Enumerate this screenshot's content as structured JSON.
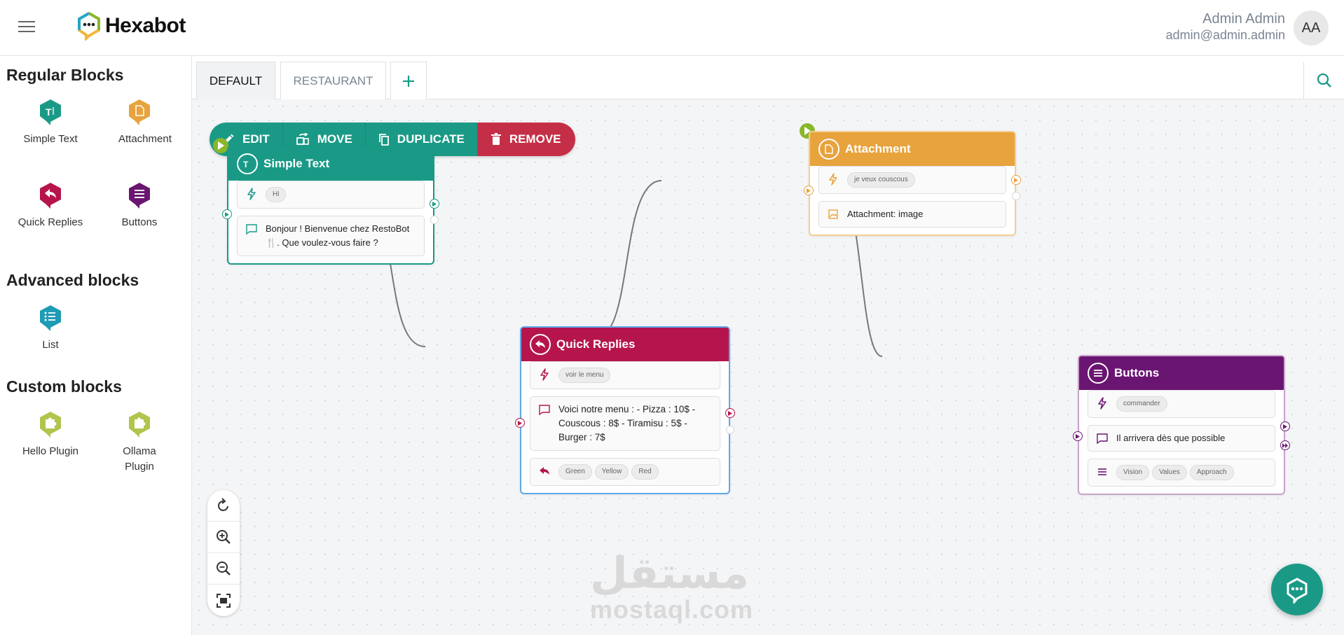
{
  "app": {
    "name": "Hexabot"
  },
  "user": {
    "name": "Admin Admin",
    "email": "admin@admin.admin",
    "initials": "AA"
  },
  "sidebar": {
    "sections": [
      {
        "title": "Regular Blocks",
        "blocks": [
          {
            "label": "Simple Text",
            "icon": "simple-text-icon",
            "color": "#1a9a86"
          },
          {
            "label": "Attachment",
            "icon": "attachment-icon",
            "color": "#e8a33d"
          },
          {
            "label": "Quick Replies",
            "icon": "quick-replies-icon",
            "color": "#b5154c"
          },
          {
            "label": "Buttons",
            "icon": "buttons-icon",
            "color": "#6b1572"
          }
        ]
      },
      {
        "title": "Advanced blocks",
        "blocks": [
          {
            "label": "List",
            "icon": "list-icon",
            "color": "#1e9bb5"
          }
        ]
      },
      {
        "title": "Custom blocks",
        "blocks": [
          {
            "label": "Hello Plugin",
            "icon": "puzzle-icon",
            "color": "#b2c44c"
          },
          {
            "label": "Ollama Plugin",
            "icon": "puzzle-icon",
            "color": "#b2c44c"
          }
        ]
      }
    ]
  },
  "tabs": [
    {
      "label": "DEFAULT",
      "active": true
    },
    {
      "label": "RESTAURANT",
      "active": false
    }
  ],
  "toolbar": {
    "edit": "EDIT",
    "move": "MOVE",
    "duplicate": "DUPLICATE",
    "remove": "REMOVE"
  },
  "nodes": {
    "simple_text": {
      "title": "Simple Text",
      "color": "#1a9a86",
      "trigger": "Hi",
      "message": "Bonjour ! Bienvenue chez RestoBot 🍴. Que voulez-vous faire ?"
    },
    "quick_replies": {
      "title": "Quick Replies",
      "color": "#b5154c",
      "trigger": "voir le menu",
      "message": "Voici notre menu : - Pizza : 10$ - Couscous : 8$ - Tiramisu : 5$ - Burger : 7$",
      "replies": [
        "Green",
        "Yellow",
        "Red"
      ]
    },
    "attachment": {
      "title": "Attachment",
      "color": "#e8a33d",
      "trigger": "je veux couscous",
      "message": "Attachment: image"
    },
    "buttons": {
      "title": "Buttons",
      "color": "#6b1572",
      "trigger": "commander",
      "message": "Il arrivera dès que possible",
      "buttons": [
        "Vision",
        "Values",
        "Approach"
      ]
    }
  },
  "watermark": {
    "arabic": "مستقل",
    "latin": "mostaql.com"
  }
}
